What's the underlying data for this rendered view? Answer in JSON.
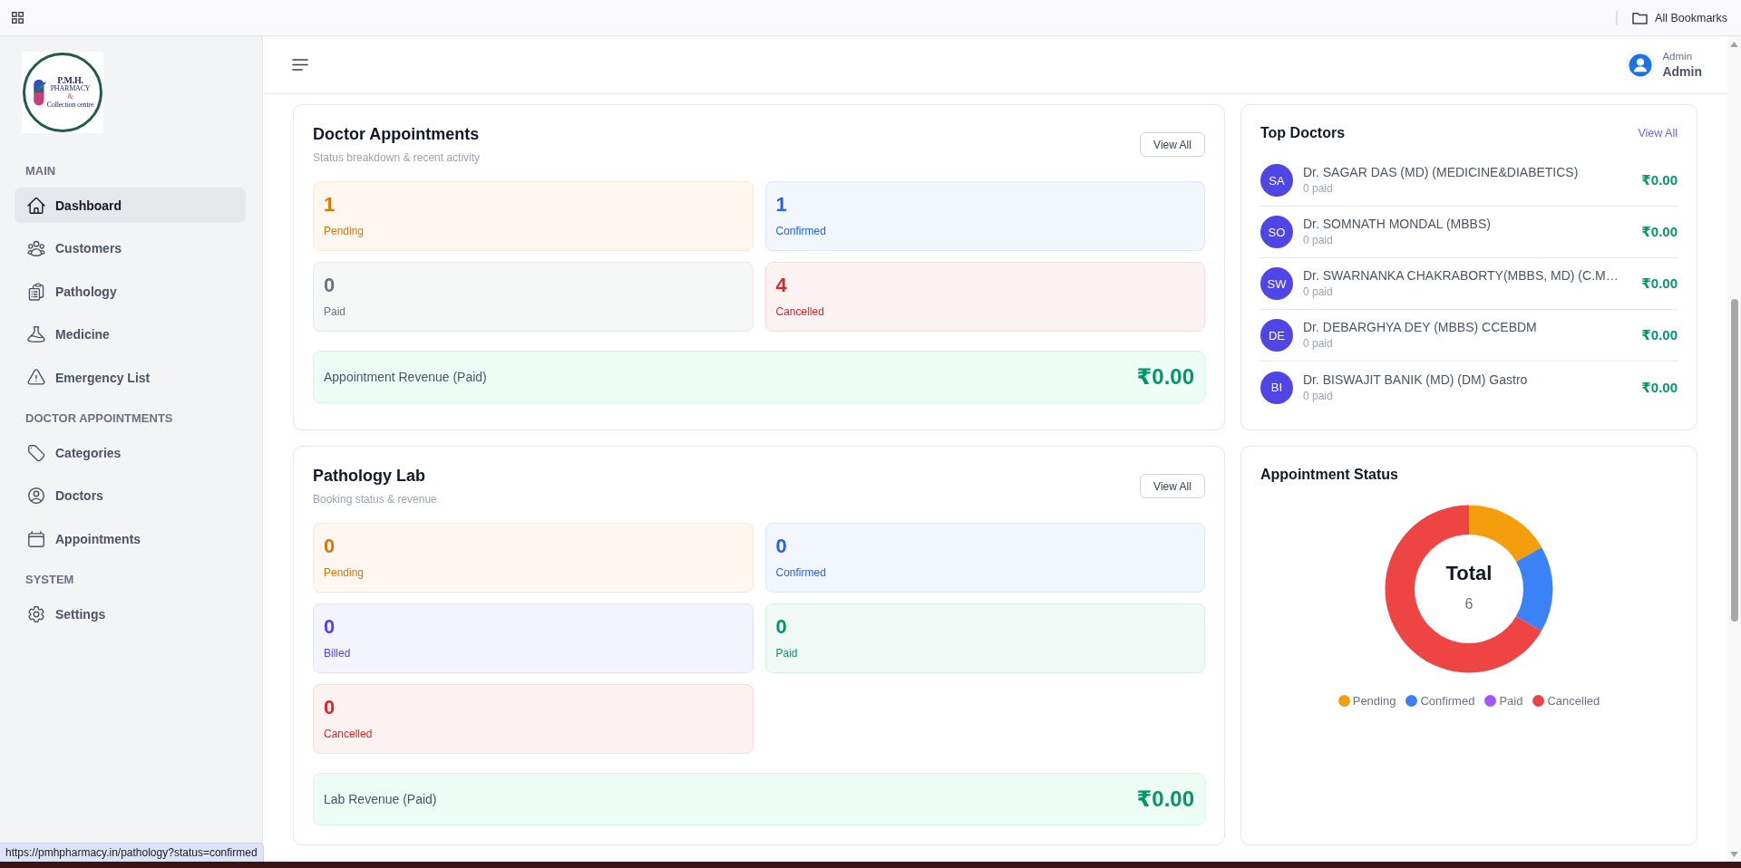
{
  "browser_bar": {
    "bookmarks_label": "All Bookmarks"
  },
  "sidebar": {
    "logo": {
      "title": "P.M.H.",
      "line_2": "PHARMACY",
      "line_3": "&",
      "line_4": "Collection centre"
    },
    "sections": [
      {
        "title": "MAIN",
        "items": [
          {
            "label": "Dashboard",
            "selected": true
          },
          {
            "label": "Customers",
            "selected": false
          },
          {
            "label": "Pathology",
            "selected": false
          },
          {
            "label": "Medicine",
            "selected": false
          },
          {
            "label": "Emergency List",
            "selected": false
          }
        ]
      },
      {
        "title": "DOCTOR APPOINTMENTS",
        "items": [
          {
            "label": "Categories",
            "selected": false
          },
          {
            "label": "Doctors",
            "selected": false
          },
          {
            "label": "Appointments",
            "selected": false
          }
        ]
      },
      {
        "title": "SYSTEM",
        "items": [
          {
            "label": "Settings",
            "selected": false
          }
        ]
      }
    ]
  },
  "header": {
    "user_role": "Admin",
    "user_name": "Admin"
  },
  "doctor_appointments": {
    "title": "Doctor Appointments",
    "subtitle": "Status breakdown & recent activity",
    "action": "View All",
    "stats": [
      {
        "value": "1",
        "label": "Pending",
        "color": "#d97706"
      },
      {
        "value": "1",
        "label": "Confirmed",
        "color": "#2563eb"
      },
      {
        "value": "0",
        "label": "Paid",
        "color": "#6b7280"
      },
      {
        "value": "4",
        "label": "Cancelled",
        "color": "#dc2626"
      }
    ],
    "revenue": {
      "label": "Appointment Revenue (Paid)",
      "amount": "₹0.00"
    }
  },
  "top_doctors": {
    "title": "Top Doctors",
    "action": "View All",
    "doctors": [
      {
        "initials": "SA",
        "name": "Dr. SAGAR DAS (MD) (MEDICINE&DIABETICS)",
        "count": "0 paid",
        "amount": "₹0.00"
      },
      {
        "initials": "SO",
        "name": "Dr. SOMNATH MONDAL (MBBS)",
        "count": "0 paid",
        "amount": "₹0.00"
      },
      {
        "initials": "SW",
        "name": "Dr. SWARNANKA CHAKRABORTY(MBBS, MD) (C.M…",
        "count": "0 paid",
        "amount": "₹0.00"
      },
      {
        "initials": "DE",
        "name": "Dr. DEBARGHYA DEY (MBBS) CCEBDM",
        "count": "0 paid",
        "amount": "₹0.00"
      },
      {
        "initials": "BI",
        "name": "Dr. BISWAJIT BANIK (MD) (DM) Gastro",
        "count": "0 paid",
        "amount": "₹0.00"
      }
    ]
  },
  "pathology_lab": {
    "title": "Pathology Lab",
    "subtitle": "Booking status & revenue",
    "action": "View All",
    "stats": [
      {
        "value": "0",
        "label": "Pending",
        "color": "#d97706"
      },
      {
        "value": "0",
        "label": "Confirmed",
        "color": "#2563eb"
      },
      {
        "value": "0",
        "label": "Billed",
        "color": "#4f46e5"
      },
      {
        "value": "0",
        "label": "Paid",
        "color": "#059669"
      },
      {
        "value": "0",
        "label": "Cancelled",
        "color": "#dc2626"
      }
    ],
    "revenue": {
      "label": "Lab Revenue (Paid)",
      "amount": "₹0.00"
    }
  },
  "appointment_status": {
    "title": "Appointment Status",
    "chart_data": {
      "type": "donut",
      "categories": [
        "Pending",
        "Confirmed",
        "Paid",
        "Cancelled"
      ],
      "values": [
        16.7,
        16.7,
        0,
        66.6
      ]
    },
    "center_label": "Total",
    "center_value": "6",
    "legend": [
      {
        "color": "#f59e0b"
      },
      {
        "color": "#3b82f6"
      },
      {
        "color": "#a855f7"
      },
      {
        "color": "#ef4444"
      }
    ]
  },
  "status_url": "https://pmhpharmacy.in/pathology?status=confirmed"
}
